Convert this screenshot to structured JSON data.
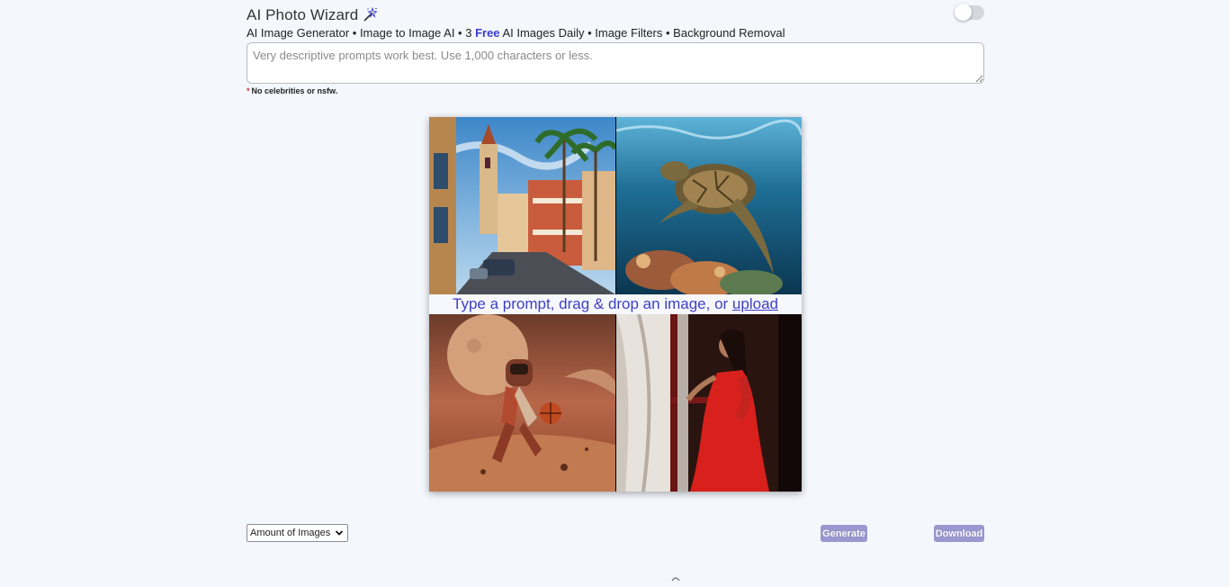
{
  "header": {
    "title": "AI Photo Wizard",
    "icon": "magic-wand-icon",
    "subtitle_before": "AI Image Generator • Image to Image AI • 3",
    "subtitle_free": "Free",
    "subtitle_after": "AI Images Daily • Image Filters • Background Removal",
    "toggle_state": "off"
  },
  "prompt": {
    "placeholder": "Very descriptive prompts work best. Use 1,000 characters or less.",
    "value": ""
  },
  "note": {
    "star": "*",
    "text": "No celebrities or nsfw."
  },
  "gallery": {
    "banner_text": "Type a prompt, drag & drop an image, or",
    "upload_link": "upload",
    "images": [
      "street-scene-image",
      "sea-turtle-image",
      "astronaut-basketball-image",
      "woman-red-dress-image"
    ]
  },
  "controls": {
    "amount_label": "Amount of Images",
    "generate_label": "Generate",
    "download_label": "Download"
  },
  "colors": {
    "accent": "#3f3fc4",
    "button": "#9a98cf",
    "background": "#f4f8fd"
  }
}
